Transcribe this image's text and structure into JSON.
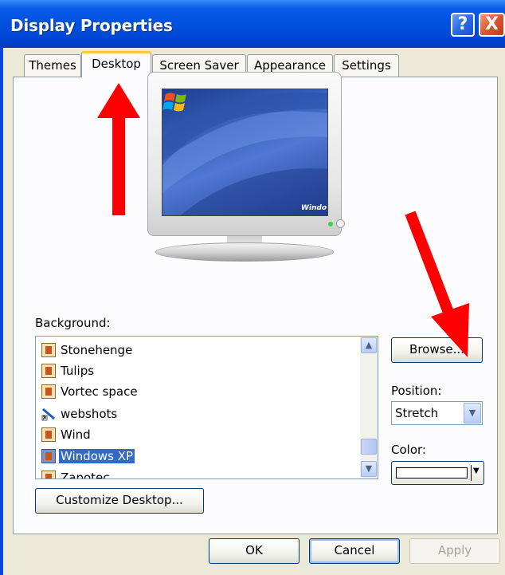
{
  "window": {
    "title": "Display Properties"
  },
  "titlebar_buttons": {
    "help": "?",
    "close": "X"
  },
  "tabs": [
    {
      "label": "Themes"
    },
    {
      "label": "Desktop"
    },
    {
      "label": "Screen Saver"
    },
    {
      "label": "Appearance"
    },
    {
      "label": "Settings"
    }
  ],
  "active_tab": "Desktop",
  "preview": {
    "logo_text": "Windows"
  },
  "background": {
    "label": "Background:",
    "items": [
      {
        "name": "Stonehenge",
        "icon": "image-file-icon"
      },
      {
        "name": "Tulips",
        "icon": "image-file-icon"
      },
      {
        "name": "Vortec space",
        "icon": "image-file-icon"
      },
      {
        "name": "webshots",
        "icon": "shortcut-icon"
      },
      {
        "name": "Wind",
        "icon": "image-file-icon"
      },
      {
        "name": "Windows XP",
        "icon": "image-file-icon",
        "selected": true
      },
      {
        "name": "Zapotec",
        "icon": "image-file-icon"
      }
    ]
  },
  "browse_label": "Browse...",
  "position": {
    "label": "Position:",
    "value": "Stretch"
  },
  "color": {
    "label": "Color:",
    "value": "#ffffff"
  },
  "customize_label": "Customize Desktop...",
  "footer": {
    "ok": "OK",
    "cancel": "Cancel",
    "apply": "Apply"
  },
  "colors": {
    "titlebar": "#0054e3",
    "selection": "#316ac5",
    "face": "#ece9d8",
    "annotation_arrow": "#ff0000"
  }
}
